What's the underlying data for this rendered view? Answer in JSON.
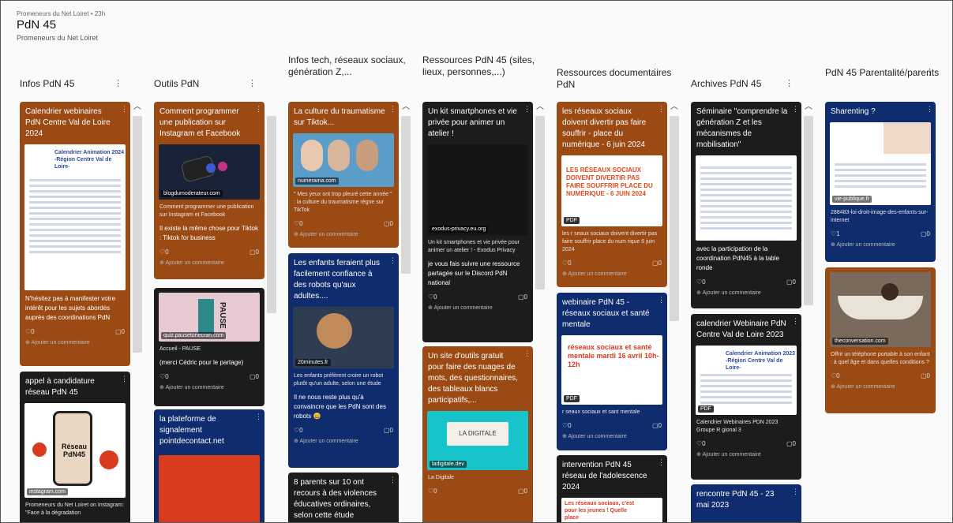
{
  "header": {
    "meta": "Promeneurs du Net Loiret • 23h",
    "title": "PdN 45",
    "subtitle": "Promeneurs du Net Loiret"
  },
  "common": {
    "add_comment": "Ajouter un commentaire",
    "zero": "0"
  },
  "columns": [
    {
      "title": "Infos PdN 45",
      "cards": [
        {
          "title": "Calendrier webinaires PdN Centre Val de Loire 2024",
          "doc_heading": "Calendrier Animation 2024 -Région Centre Val de Loire-",
          "body": "N'hésitez pas à manifester votre intérêt pour les sujets abordés auprès des coordinations PdN"
        },
        {
          "title": "appel à candidature réseau PdN 45",
          "img_label": "Réseau PdN45",
          "source": "instagram.com",
          "desc": "Promeneurs du Net Loiret on Instagram: \"Face à la dégradation"
        }
      ]
    },
    {
      "title": "Outils PdN",
      "cards": [
        {
          "title": "Comment programmer une publication sur Instagram et Facebook",
          "source": "blogdumoderateur.com",
          "desc": "Comment programmer une publication sur Instagram et Facebook",
          "body": "Il existe la même chose pour Tiktok : Tiktok for business"
        },
        {
          "source": "quiz.pausetonecran.com",
          "img_label": "PAUSE",
          "desc": "Accueil - PAUSE",
          "body": "(merci Cédric pour le partage)"
        },
        {
          "title": "la plateforme de signalement pointdecontact.net"
        }
      ]
    },
    {
      "title": "Infos tech, réseaux sociaux, génération Z,...",
      "cards": [
        {
          "title": "La culture du traumatisme sur Tiktok...",
          "source": "numerama.com",
          "desc": "\" Mes yeux ont trop pleuré cette année \" : la culture du traumatisme règne sur TikTok"
        },
        {
          "title": "Les enfants feraient plus facilement confiance à des robots qu'aux adultes....",
          "source": "20minutes.fr",
          "desc": "Les enfants préfèrent croire un robot plutôt qu'un adulte, selon une étude",
          "body": "Il ne nous reste plus qu'à convaincre que les PdN sont des robots 😀"
        },
        {
          "title": "8 parents sur 10 ont recours à des violences éducatives ordinaires, selon cette étude"
        }
      ]
    },
    {
      "title": "Ressources PdN 45 (sites, lieux, personnes,...)",
      "cards": [
        {
          "title": "Un kit smartphones et vie privée pour animer un atelier !",
          "source": "exodus-privacy.eu.org",
          "desc": "Un kit smartphones et vie privée pour animer un atelier ! - Exodus Privacy",
          "body": "je vous fais suivre une ressource partagée sur le Discord PdN national"
        },
        {
          "title": "Un site d'outils gratuit pour faire des nuages de mots, des questionnaires, des tableaux blancs participatifs,...",
          "img_label": "LA DIGITALE",
          "source": "ladigitale.dev",
          "desc": "La Digitale"
        }
      ]
    },
    {
      "title": "Ressources documentaires PdN",
      "cards": [
        {
          "title": "les réseaux sociaux doivent divertir pas faire souffrir - place du numérique - 6 juin 2024",
          "img_label": "LES RÉSEAUX SOCIAUX DOIVENT DIVERTIR PAS FAIRE SOUFFRIR PLACE DU NUMÉRIQUE - 6 JUIN 2024",
          "tag": "PDF",
          "desc": "les r seaux sociaux doivent divertir pas faire souffrir place du num rique 6 juin 2024"
        },
        {
          "title": "webinaire PdN 45 - réseaux sociaux et santé mentale",
          "img_label": "réseaux sociaux et santé mentale mardi 16 avril 10h-12h",
          "tag": "PDF",
          "desc": "r seaux sociaux et sant mentale"
        },
        {
          "title": "intervention PdN 45 réseau de l'adolescence 2024",
          "img_label": "Les réseaux sociaux, c'est pour les jeunes ! Quelle place"
        }
      ]
    },
    {
      "title": "Archives PdN 45",
      "cards": [
        {
          "title": "Séminaire \"comprendre la génération Z et les mécanismes de mobilisation\"",
          "body": "avec la participation de la coordination PdN45 à la table ronde"
        },
        {
          "title": "calendrier Webinaire PdN Centre Val de Loire 2023",
          "doc_heading": "Calendrier Animation 2023 -Région Centre Val de Loire-",
          "tag": "PDF",
          "desc": "Calendrier Webinaires PDN 2023 Groupe R gional 3"
        },
        {
          "title": "rencontre PdN 45 - 23 mai 2023"
        }
      ]
    },
    {
      "title": "PdN 45 Parentalité/parents",
      "cards": [
        {
          "title": "Sharenting ?",
          "source": "vie-publique.fr",
          "desc": "288483-loi-droit-image-des-enfants-sur-internet",
          "count": "1"
        },
        {
          "source": "theconversation.com",
          "desc": "Offrir un téléphone portable à son enfant : à quel âge et dans quelles conditions ?"
        }
      ]
    }
  ]
}
